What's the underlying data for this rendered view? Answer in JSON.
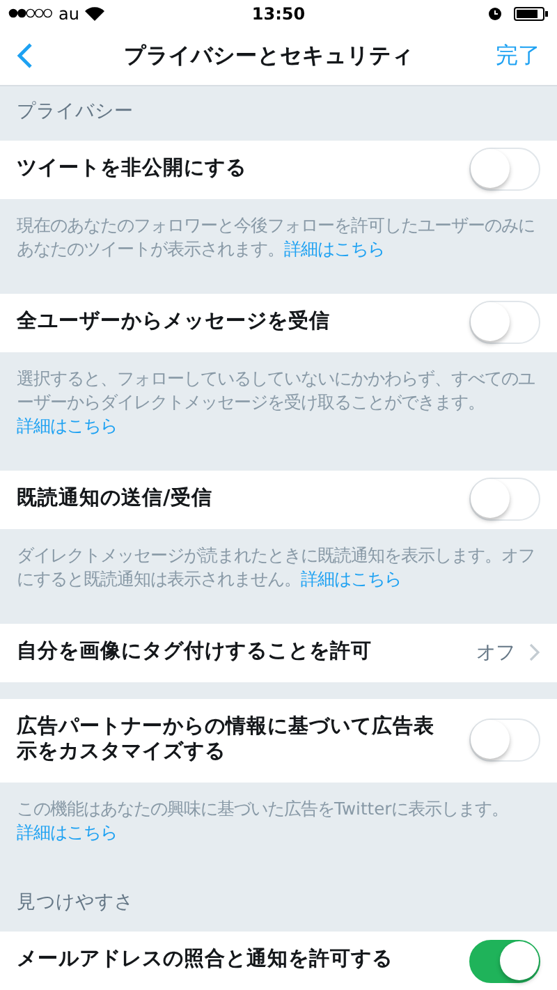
{
  "status_bar": {
    "carrier": "au",
    "time": "13:50"
  },
  "nav": {
    "title": "プライバシーとセキュリティ",
    "done": "完了"
  },
  "items": [
    {
      "kind": "section",
      "label": "プライバシー"
    },
    {
      "kind": "toggle",
      "label": "ツイートを非公開にする",
      "on": false
    },
    {
      "kind": "note",
      "text": "現在のあなたのフォロワーと今後フォローを許可したユーザーのみにあなたのツイートが表示されます。",
      "link": "詳細はこちら"
    },
    {
      "kind": "toggle",
      "label": "全ユーザーからメッセージを受信",
      "on": false
    },
    {
      "kind": "note",
      "text": "選択すると、フォローしているしていないにかかわらず、すべてのユーザーからダイレクトメッセージを受け取ることができます。 ",
      "link": "詳細はこちら"
    },
    {
      "kind": "toggle",
      "label": "既読通知の送信/受信",
      "on": false
    },
    {
      "kind": "note",
      "text": "ダイレクトメッセージが読まれたときに既読通知を表示します。オフにすると既読通知は表示されません。",
      "link": "詳細はこちら"
    },
    {
      "kind": "link",
      "label": "自分を画像にタグ付けすることを許可",
      "value": "オフ"
    },
    {
      "kind": "gap"
    },
    {
      "kind": "toggle",
      "label": "広告パートナーからの情報に基づいて広告表示をカスタマイズする",
      "on": false
    },
    {
      "kind": "note",
      "text": "この機能はあなたの興味に基づいた広告をTwitterに表示します。",
      "link": "詳細はこちら"
    },
    {
      "kind": "section",
      "label": "見つけやすさ"
    },
    {
      "kind": "toggle",
      "label": "メールアドレスの照合と通知を許可する",
      "on": true
    }
  ]
}
